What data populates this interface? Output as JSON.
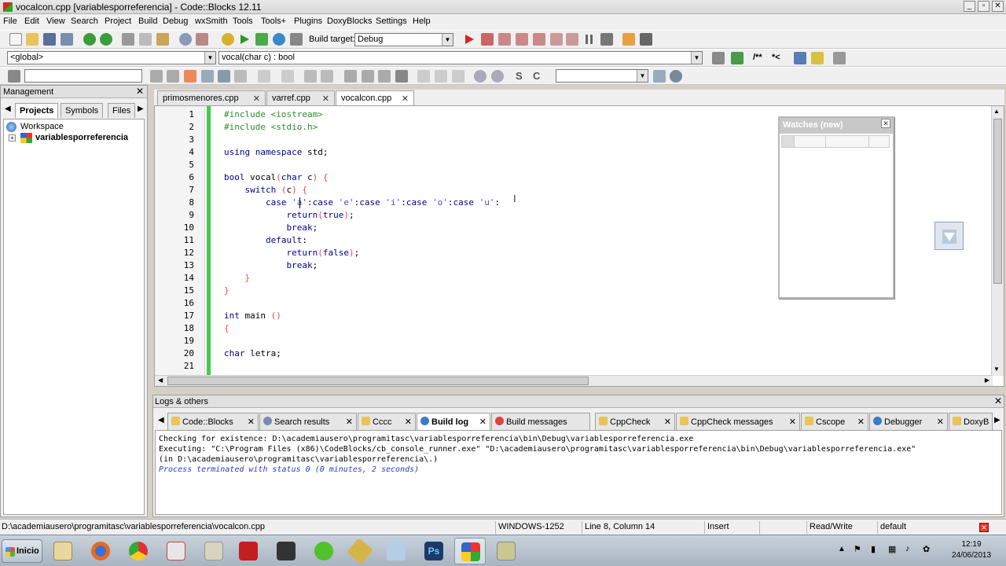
{
  "window": {
    "title": "vocalcon.cpp [variablesporreferencia] - Code::Blocks 12.11"
  },
  "menu": [
    "File",
    "Edit",
    "View",
    "Search",
    "Project",
    "Build",
    "Debug",
    "wxSmith",
    "Tools",
    "Tools+",
    "Plugins",
    "DoxyBlocks",
    "Settings",
    "Help"
  ],
  "toolbar": {
    "build_target_label": "Build target:",
    "build_target_value": "Debug",
    "scope_value": "<global>",
    "function_value": "vocal(char c) : bool",
    "search_value": ""
  },
  "management": {
    "title": "Management",
    "tabs": [
      "Projects",
      "Symbols",
      "Files"
    ],
    "workspace": "Workspace",
    "project": "variablesporreferencia"
  },
  "editor": {
    "tabs": [
      "primosmenores.cpp",
      "varref.cpp",
      "vocalcon.cpp"
    ],
    "active_tab": "vocalcon.cpp",
    "line_numbers": [
      "1",
      "2",
      "3",
      "4",
      "5",
      "6",
      "7",
      "8",
      "9",
      "10",
      "11",
      "12",
      "13",
      "14",
      "15",
      "16",
      "17",
      "18",
      "19",
      "20",
      "21"
    ]
  },
  "watches": {
    "title": "Watches (new)"
  },
  "logs": {
    "title": "Logs & others",
    "tabs": [
      "Code::Blocks",
      "Search results",
      "Cccc",
      "Build log",
      "Build messages",
      "CppCheck",
      "CppCheck messages",
      "Cscope",
      "Debugger",
      "DoxyB"
    ],
    "active_tab": "Build log",
    "lines": [
      "Checking for existence: D:\\academiausero\\programitasc\\variablesporreferencia\\bin\\Debug\\variablesporreferencia.exe",
      "Executing: \"C:\\Program Files (x86)\\CodeBlocks/cb_console_runner.exe\" \"D:\\academiausero\\programitasc\\variablesporreferencia\\bin\\Debug\\variablesporreferencia.exe\"",
      "(in D:\\academiausero\\programitasc\\variablesporreferencia\\.)",
      "Process terminated with status 0 (0 minutes, 2 seconds)"
    ]
  },
  "status": {
    "path": "D:\\academiausero\\programitasc\\variablesporreferencia\\vocalcon.cpp",
    "encoding": "WINDOWS-1252",
    "position": "Line 8, Column 14",
    "mode": "Insert",
    "access": "Read/Write",
    "lang": "default"
  },
  "taskbar": {
    "start_label": "Inicio",
    "time": "12:19",
    "date": "24/06/2013"
  }
}
